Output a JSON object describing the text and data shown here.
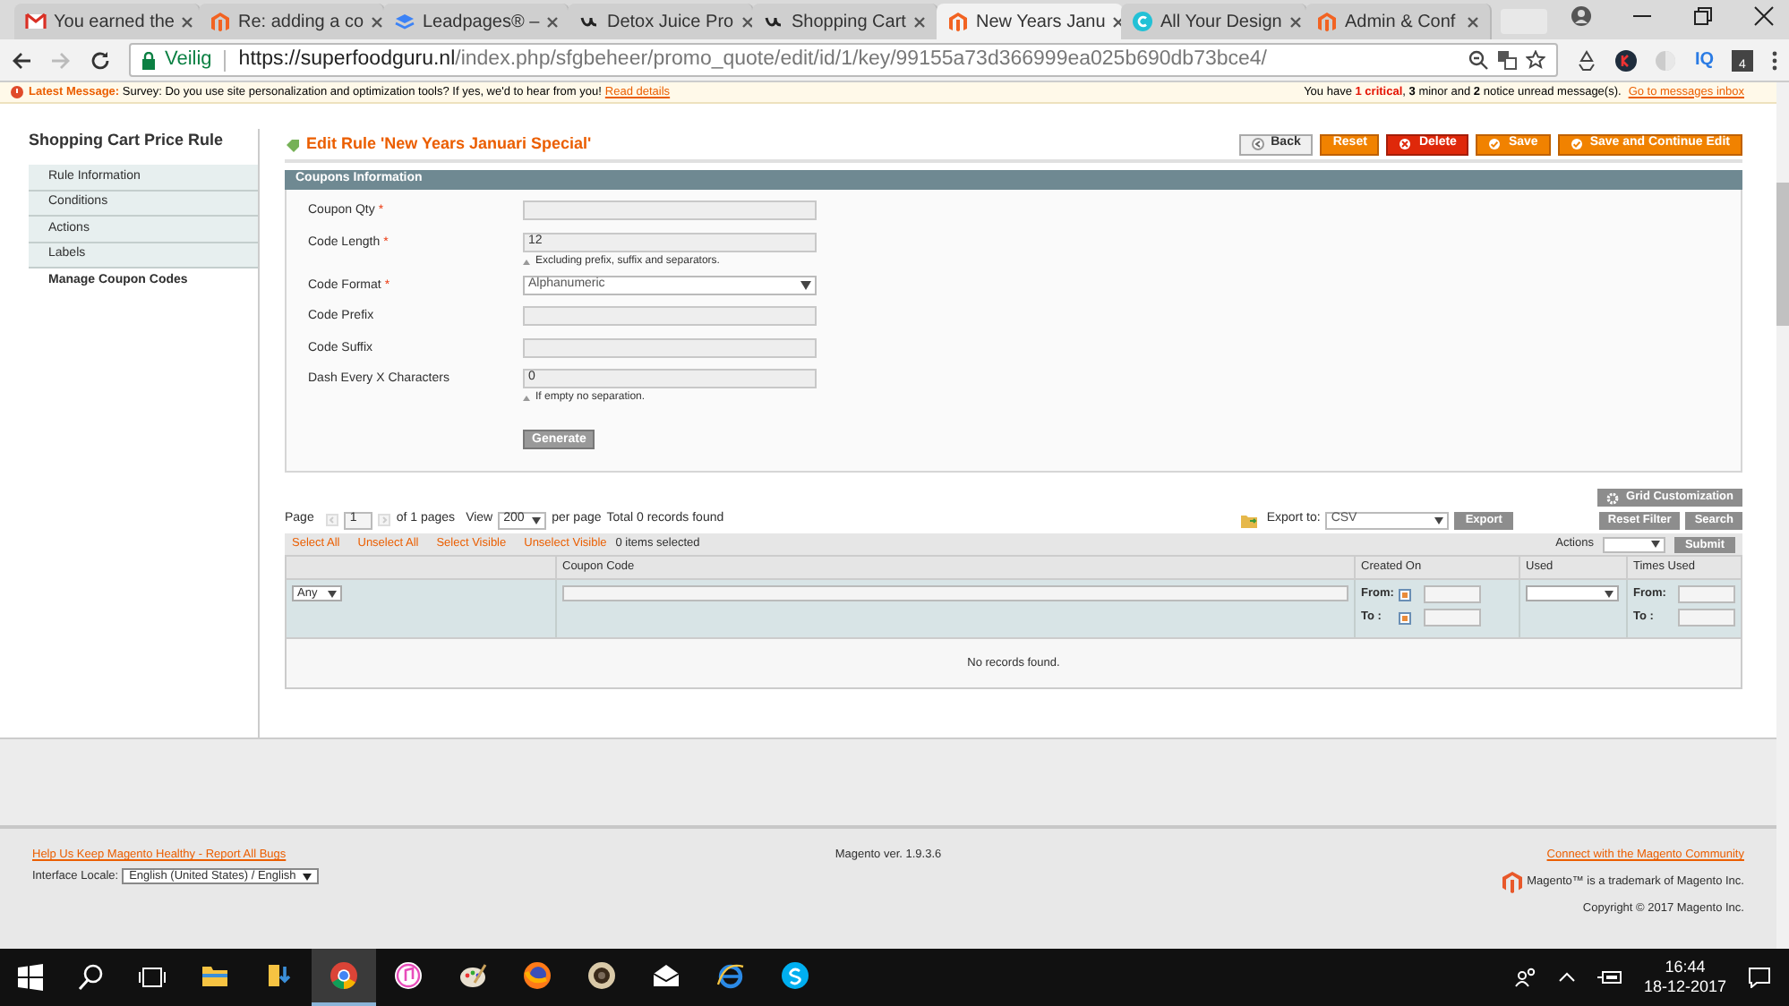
{
  "browser": {
    "tabs": [
      {
        "title": "You earned the",
        "kind": "gmail",
        "selected": false
      },
      {
        "title": "Re: adding a co",
        "kind": "magento",
        "selected": false
      },
      {
        "title": "Leadpages® –",
        "kind": "layers",
        "selected": false
      },
      {
        "title": "Detox Juice Pro",
        "kind": "u",
        "selected": false
      },
      {
        "title": "Shopping Cart",
        "kind": "u",
        "selected": false
      },
      {
        "title": "New Years Janu",
        "kind": "magento",
        "selected": true
      },
      {
        "title": "All Your Design",
        "kind": "c",
        "selected": false
      },
      {
        "title": "Admin & Conf",
        "kind": "magento",
        "selected": false
      }
    ],
    "extension_label": "IQ",
    "secure_label": "Veilig",
    "url_host": "https://superfoodguru.nl",
    "url_path": "/index.php/sfgbeheer/promo_quote/edit/id/1/key/99155a73d366999ea025b690db73bce4/",
    "extension_badge": "4"
  },
  "message_bar": {
    "label": "Latest Message:",
    "text": "Survey: Do you use site personalization and optimization tools? If yes, we'd to hear from you!",
    "link": "Read details",
    "notice_prefix": "You have",
    "notice_critical": "1 critical",
    "notice_rest": ", **3** minor and **2** notice unread message(s).",
    "notice_link": "Go to messages inbox"
  },
  "sidebar": {
    "title": "Shopping Cart Price Rule",
    "items": [
      {
        "label": "Rule Information",
        "selected": false
      },
      {
        "label": "Conditions",
        "selected": false
      },
      {
        "label": "Actions",
        "selected": false
      },
      {
        "label": "Labels",
        "selected": false
      },
      {
        "label": "Manage Coupon Codes",
        "selected": true
      }
    ]
  },
  "page_title": "Edit Rule 'New Years Januari Special'",
  "buttons": [
    {
      "label": "Back",
      "kind": "back"
    },
    {
      "label": "Reset",
      "kind": "plain"
    },
    {
      "label": "Delete",
      "kind": "delete"
    },
    {
      "label": "Save",
      "kind": "save"
    },
    {
      "label": "Save and Continue Edit",
      "kind": "save"
    }
  ],
  "section": {
    "title": "Coupons Information",
    "required_mark": "*",
    "fields": [
      {
        "label": "Coupon Qty",
        "required": true,
        "kind": "text"
      },
      {
        "label": "Code Length",
        "required": true,
        "kind": "text",
        "value": "12",
        "note": "Excluding prefix, suffix and separators."
      },
      {
        "label": "Code Format",
        "required": true,
        "kind": "select",
        "value": "Alphanumeric"
      },
      {
        "label": "Code Prefix",
        "required": false,
        "kind": "text"
      },
      {
        "label": "Code Suffix",
        "required": false,
        "kind": "text"
      },
      {
        "label": "Dash Every X Characters",
        "required": false,
        "kind": "text",
        "value": "0",
        "note": "If empty no separation."
      }
    ],
    "generate_button": "Generate"
  },
  "grid": {
    "customization_button": "Grid Customization",
    "reset_button": "Reset Filter",
    "search_button": "Search",
    "pager": {
      "page_label": "Page",
      "page": "1",
      "of_pages": "of 1 pages",
      "view_label": "View",
      "view": "200",
      "per_page": "per page",
      "total": "Total 0 records found"
    },
    "export_label": "Export to:",
    "export_value": "CSV",
    "export_button": "Export",
    "mass_links": [
      "Select All",
      "Unselect All",
      "Select Visible",
      "Unselect Visible"
    ],
    "selected_count": "0 items selected",
    "actions_label": "Actions",
    "submit_button": "Submit",
    "columns": [
      "Coupon Code",
      "Created On",
      "Used",
      "Times Used"
    ],
    "filter_any": "Any",
    "created_from_label": "From:",
    "created_to_label": "To :",
    "times_from_label": "From:",
    "times_to_label": "To :",
    "empty_text": "No records found."
  },
  "footer": {
    "help_link": "Help Us Keep Magento Healthy - Report All Bugs",
    "locale_label": "Interface Locale:",
    "locale_value": "English (United States) / English",
    "version": "Magento ver. 1.9.3.6",
    "community_link": "Connect with the Magento Community",
    "trademark": "Magento™ is a trademark of Magento Inc.",
    "copyright": "Copyright © 2017 Magento Inc."
  },
  "taskbar": {
    "apps": [
      {
        "kind": "explorer",
        "active": false
      },
      {
        "kind": "downloads",
        "active": false
      },
      {
        "kind": "chrome",
        "active": true
      },
      {
        "kind": "itunes",
        "active": false
      },
      {
        "kind": "paint",
        "active": false
      },
      {
        "kind": "firefox",
        "active": false
      },
      {
        "kind": "camera",
        "active": false
      },
      {
        "kind": "mail",
        "active": false
      },
      {
        "kind": "ie",
        "active": false
      },
      {
        "kind": "skype",
        "active": false
      }
    ],
    "time": "16:44",
    "date": "18-12-2017"
  }
}
